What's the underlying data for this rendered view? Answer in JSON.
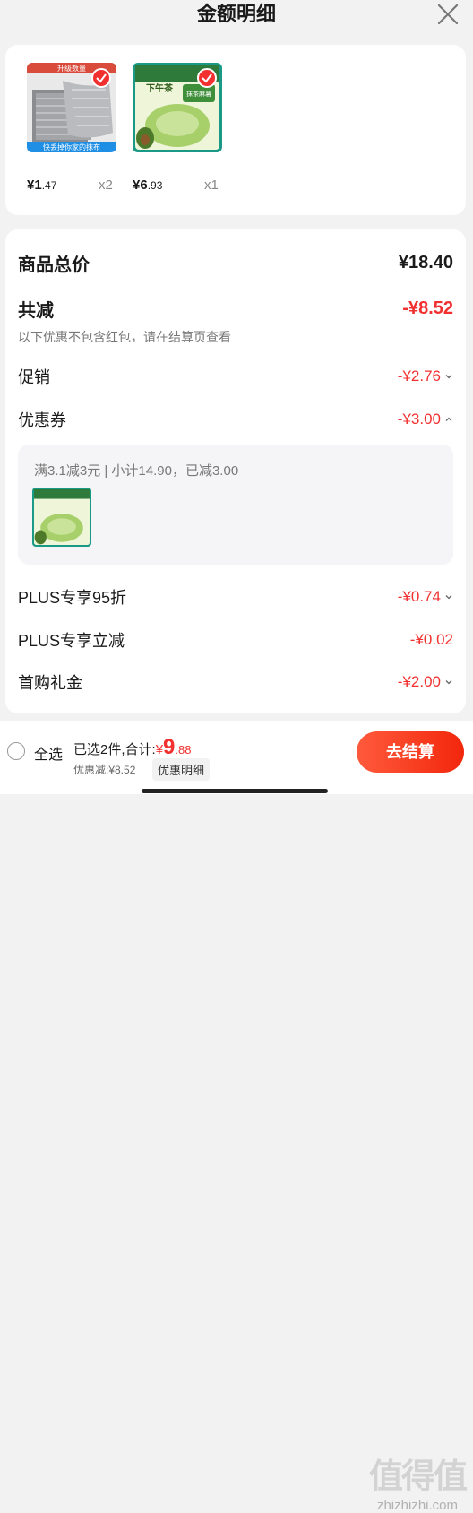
{
  "header": {
    "title": "金额明细"
  },
  "products": [
    {
      "price_int": "¥1",
      "price_dec": ".47",
      "qty": "x2",
      "caption": "快丢掉你家的抹布",
      "banner": "升级数量"
    },
    {
      "price_int": "¥6",
      "price_dec": ".93",
      "qty": "x1",
      "caption": "下午茶",
      "banner": "抹茶麻薯"
    }
  ],
  "summary": {
    "total_label": "商品总价",
    "total_value": "¥18.40",
    "reduce_label": "共减",
    "reduce_value": "-¥8.52",
    "note": "以下优惠不包含红包，请在结算页查看"
  },
  "lines": [
    {
      "label": "促销",
      "value": "-¥2.76"
    },
    {
      "label": "优惠券",
      "value": "-¥3.00"
    },
    {
      "label": "PLUS专享95折",
      "value": "-¥0.74"
    },
    {
      "label": "PLUS专享立减",
      "value": "-¥0.02"
    },
    {
      "label": "首购礼金",
      "value": "-¥2.00"
    }
  ],
  "coupon": {
    "desc": "满3.1减3元 | 小计14.90，已减3.00"
  },
  "bottom": {
    "select_all": "全选",
    "selected_text": "已选2件,合计:",
    "currency": "¥",
    "total_int": "9",
    "total_dec": ".88",
    "discount_text": "优惠减:¥8.52",
    "detail_link": "优惠明细",
    "checkout": "去结算"
  },
  "watermark": {
    "big": "值得值",
    "small": "zhizhizhi.com"
  },
  "colors": {
    "accent": "#f23030",
    "card_bg": "#ffffff",
    "page_bg": "#f2f2f2"
  }
}
